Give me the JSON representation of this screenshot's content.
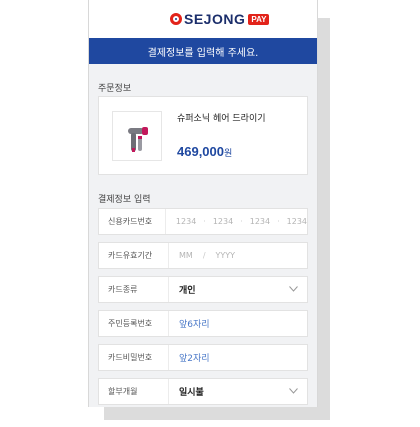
{
  "logo": {
    "text": "SEJONG",
    "badge": "PAY"
  },
  "header": {
    "title": "결제정보를 입력해 주세요."
  },
  "order": {
    "section_title": "주문정보",
    "product": {
      "name": "슈퍼소닉 헤어 드라이기",
      "price": "469,000",
      "unit": "원"
    }
  },
  "payment": {
    "section_title": "결제정보 입력",
    "card_number": {
      "label": "신용카드번호",
      "placeholders": [
        "1234",
        "1234",
        "1234",
        "1234"
      ]
    },
    "expiry": {
      "label": "카드유효기간",
      "month": "MM",
      "sep": "/",
      "year": "YYYY"
    },
    "card_type": {
      "label": "카드종류",
      "value": "개인"
    },
    "resident_id": {
      "label": "주민등록번호",
      "value": "앞6자리"
    },
    "password": {
      "label": "카드비밀번호",
      "value": "앞2자리"
    },
    "installment": {
      "label": "할부개월",
      "value": "일시불"
    }
  },
  "colors": {
    "brand_blue": "#1f48a0",
    "brand_red": "#e2231a",
    "background": "#f1f2f4"
  },
  "icons": [
    "sejong-logo-icon",
    "hair-dryer-icon",
    "chevron-down-icon"
  ]
}
